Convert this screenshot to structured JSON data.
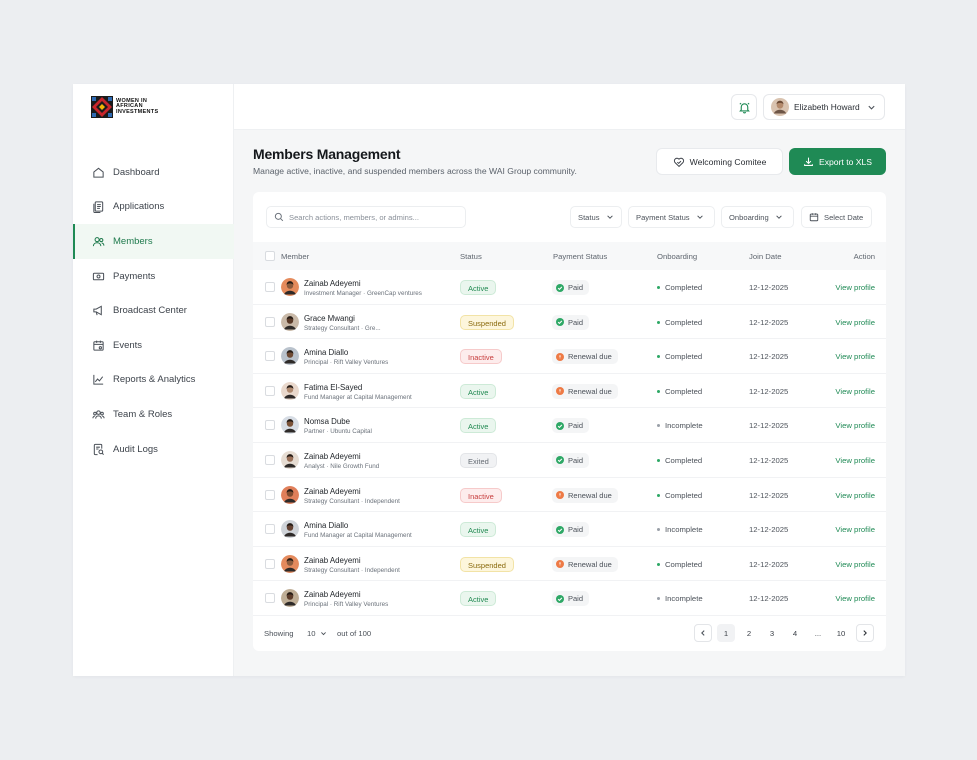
{
  "brand": {
    "line1": "WOMEN IN",
    "line2": "AFRICAN",
    "line3": "INVESTMENTS"
  },
  "sidebar": {
    "items": [
      {
        "label": "Dashboard",
        "icon": "home-icon"
      },
      {
        "label": "Applications",
        "icon": "documents-icon"
      },
      {
        "label": "Members",
        "icon": "users-icon",
        "active": true
      },
      {
        "label": "Payments",
        "icon": "money-icon"
      },
      {
        "label": "Broadcast Center",
        "icon": "megaphone-icon"
      },
      {
        "label": "Events",
        "icon": "calendar-icon"
      },
      {
        "label": "Reports & Analytics",
        "icon": "chart-icon"
      },
      {
        "label": "Team & Roles",
        "icon": "team-icon"
      },
      {
        "label": "Audit Logs",
        "icon": "audit-icon"
      }
    ]
  },
  "topbar": {
    "user_name": "Elizabeth Howard"
  },
  "page": {
    "title": "Members Management",
    "subtitle": "Manage active, inactive, and suspended members across the WAI Group community.",
    "welcoming_label": "Welcoming Comitee",
    "export_label": "Export to XLS"
  },
  "toolbar": {
    "search_placeholder": "Search actions, members, or admins...",
    "filter_status": "Status",
    "filter_payment": "Payment Status",
    "filter_onboarding": "Onboarding",
    "select_date": "Select Date"
  },
  "table": {
    "columns": {
      "member": "Member",
      "status": "Status",
      "payment": "Payment Status",
      "onboarding": "Onboarding",
      "join_date": "Join Date",
      "action": "Action"
    },
    "rows": [
      {
        "name": "Zainab Adeyemi",
        "sub": "Investment Manager · GreenCap ventures",
        "status": "Active",
        "payment": "Paid",
        "onboarding": "Completed",
        "date": "12-12-2025",
        "action": "View profile"
      },
      {
        "name": "Grace Mwangi",
        "sub": "Strategy Consultant · Gre...",
        "status": "Suspended",
        "payment": "Paid",
        "onboarding": "Completed",
        "date": "12-12-2025",
        "action": "View profile"
      },
      {
        "name": "Amina Diallo",
        "sub": "Principal · Rift Valley Ventures",
        "status": "Inactive",
        "payment": "Renewal due",
        "onboarding": "Completed",
        "date": "12-12-2025",
        "action": "View profile"
      },
      {
        "name": "Fatima El-Sayed",
        "sub": "Fund Manager at Capital Management",
        "status": "Active",
        "payment": "Renewal due",
        "onboarding": "Completed",
        "date": "12-12-2025",
        "action": "View profile"
      },
      {
        "name": "Nomsa Dube",
        "sub": "Partner · Ubuntu Capital",
        "status": "Active",
        "payment": "Paid",
        "onboarding": "Incomplete",
        "date": "12-12-2025",
        "action": "View profile"
      },
      {
        "name": "Zainab Adeyemi",
        "sub": "Analyst · Nile Growth Fund",
        "status": "Exited",
        "payment": "Paid",
        "onboarding": "Completed",
        "date": "12-12-2025",
        "action": "View profile"
      },
      {
        "name": "Zainab Adeyemi",
        "sub": "Strategy Consultant · Independent",
        "status": "Inactive",
        "payment": "Renewal due",
        "onboarding": "Completed",
        "date": "12-12-2025",
        "action": "View profile"
      },
      {
        "name": "Amina Diallo",
        "sub": "Fund Manager at Capital Management",
        "status": "Active",
        "payment": "Paid",
        "onboarding": "Incomplete",
        "date": "12-12-2025",
        "action": "View profile"
      },
      {
        "name": "Zainab Adeyemi",
        "sub": "Strategy Consultant · Independent",
        "status": "Suspended",
        "payment": "Renewal due",
        "onboarding": "Completed",
        "date": "12-12-2025",
        "action": "View profile"
      },
      {
        "name": "Zainab Adeyemi",
        "sub": "Principal · Rift Valley Ventures",
        "status": "Active",
        "payment": "Paid",
        "onboarding": "Incomplete",
        "date": "12-12-2025",
        "action": "View profile"
      }
    ]
  },
  "pagination": {
    "showing_label": "Showing",
    "page_size": "10",
    "out_of": "out of 100",
    "pages": [
      "1",
      "2",
      "3",
      "4",
      "...",
      "10"
    ],
    "current": "1"
  },
  "colors": {
    "accent": "#1f8a55",
    "paid": "#2ea866",
    "renewal": "#ee7a45",
    "inactive_red": "#c73d3d",
    "suspended_amber": "#8a6a0d"
  }
}
